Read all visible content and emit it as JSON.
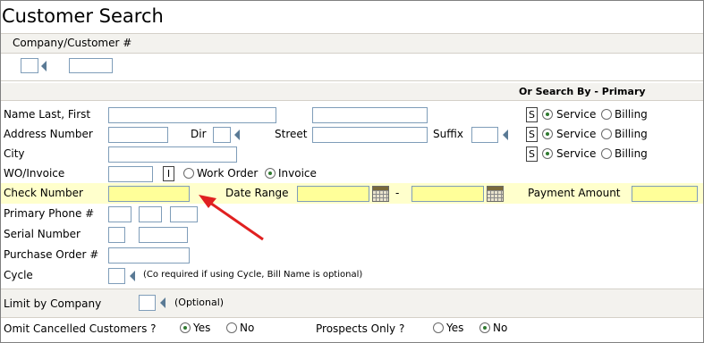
{
  "title": "Customer Search",
  "company": {
    "label": "Company/Customer #"
  },
  "section_header": "Or Search By - Primary",
  "fields": {
    "name": "Name Last, First",
    "address": "Address Number",
    "dir": "Dir",
    "street": "Street",
    "suffix": "Suffix",
    "city": "City",
    "wo": "WO/Invoice",
    "check": "Check Number",
    "date_range": "Date Range",
    "dash": "-",
    "payment": "Payment Amount",
    "phone": "Primary Phone #",
    "serial": "Serial Number",
    "po": "Purchase Order #",
    "cycle": "Cycle",
    "cycle_note": "(Co required if using Cycle, Bill Name is optional)",
    "limit": "Limit by Company",
    "limit_note": "(Optional)",
    "omit": "Omit Cancelled Customers ?",
    "prospects": "Prospects Only ?"
  },
  "s_button": "S",
  "i_button": "I",
  "service": "Service",
  "billing": "Billing",
  "work_order": "Work Order",
  "invoice": "Invoice",
  "yes": "Yes",
  "no": "No",
  "selected": {
    "name_type": "Service",
    "address_type": "Service",
    "city_type": "Service",
    "wo_type": "Invoice",
    "omit_cancelled": "Yes",
    "prospects_only": "No"
  },
  "colors": {
    "highlight": "#ffffcc",
    "required_field": "#ffff99",
    "arrow": "#e02020",
    "band": "#f3f2ee"
  }
}
